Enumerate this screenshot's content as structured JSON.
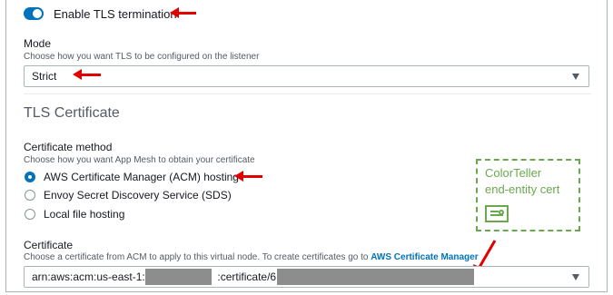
{
  "tls": {
    "toggle_label": "Enable TLS termination",
    "toggle_on": true
  },
  "mode": {
    "label": "Mode",
    "description": "Choose how you want TLS to be configured on the listener",
    "selected": "Strict"
  },
  "section": {
    "title": "TLS Certificate"
  },
  "cert_method": {
    "label": "Certificate method",
    "description": "Choose how you want App Mesh to obtain your certificate",
    "options": [
      {
        "label": "AWS Certificate Manager (ACM) hosting",
        "checked": true
      },
      {
        "label": "Envoy Secret Discovery Service (SDS)",
        "checked": false
      },
      {
        "label": "Local file hosting",
        "checked": false
      }
    ]
  },
  "callout": {
    "line1": "ColorTeller",
    "line2": "end-entity cert",
    "icon": "certificate-icon",
    "color": "#6aa84f"
  },
  "certificate": {
    "label": "Certificate",
    "description": "Choose a certificate from ACM to apply to this virtual node. To create certificates go to",
    "link_text": "AWS Certificate Manager",
    "value_prefix": "arn:aws:acm:us-east-1:1",
    "value_middle": ":certificate/6"
  },
  "colors": {
    "accent": "#0073bb",
    "annotation": "#e00000"
  }
}
